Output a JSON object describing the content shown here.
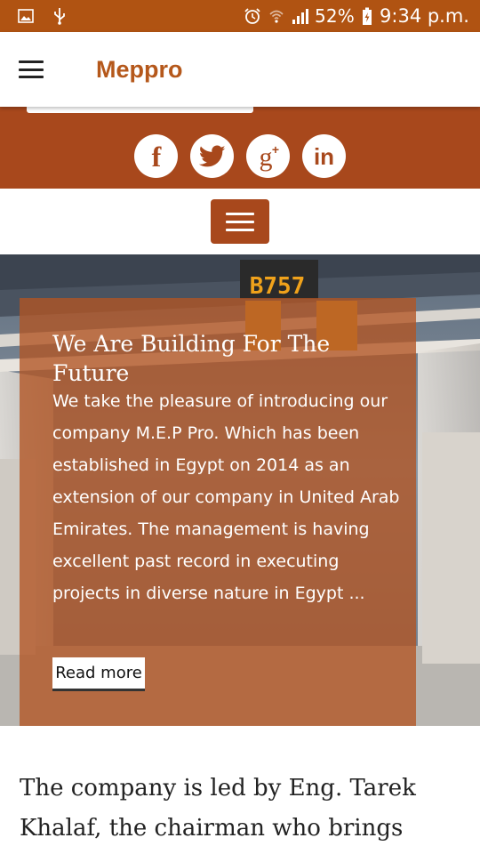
{
  "status_bar": {
    "battery": "52%",
    "time": "9:34 p.m.",
    "icons": [
      "image-icon",
      "usb-icon",
      "alarm-icon",
      "wifi-icon",
      "signal-icon",
      "battery-charging-icon"
    ]
  },
  "app_bar": {
    "title": "Meppro",
    "menu_icon": "hamburger-icon"
  },
  "social": {
    "items": [
      {
        "name": "facebook",
        "glyph": "f"
      },
      {
        "name": "twitter",
        "glyph": ""
      },
      {
        "name": "google-plus",
        "glyph": "g+"
      },
      {
        "name": "linkedin",
        "glyph": "in"
      }
    ]
  },
  "hero": {
    "sign_text": "B757",
    "title": "We Are Building For The Future",
    "body": "We take the pleasure of introducing our company M.E.P Pro. Which has been established in Egypt on 2014 as an extension of our company in United Arab Emirates. The management is having excellent past record in executing projects in diverse nature in Egypt ...",
    "read_more": "Read more"
  },
  "intro": {
    "text": "The company is led by Eng. Tarek Khalaf, the chairman who brings"
  },
  "colors": {
    "status_bar": "#b05312",
    "brand": "#a8481c",
    "title": "#b5581b",
    "overlay": "#b25422"
  }
}
